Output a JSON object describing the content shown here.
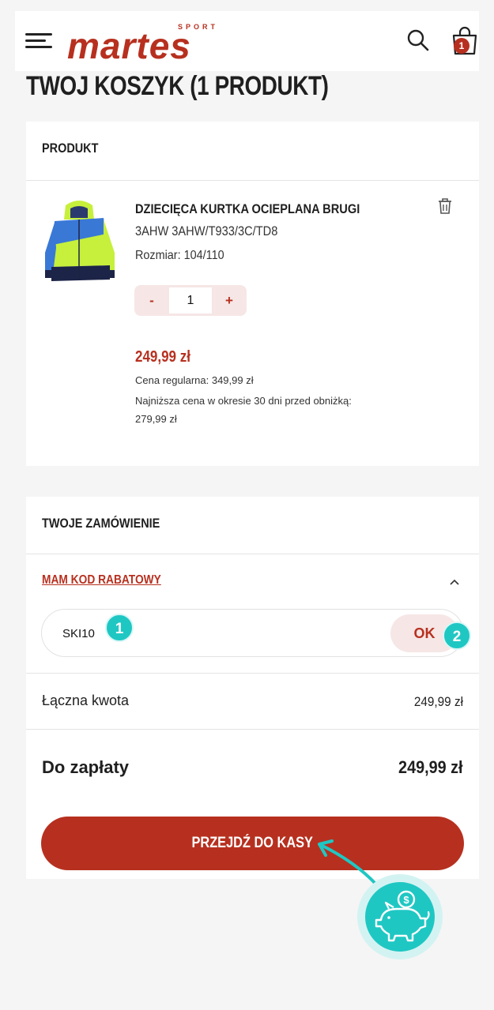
{
  "header": {
    "logo_text": "martes",
    "logo_sub": "SPORT",
    "cart_count": "1"
  },
  "page": {
    "title": "TWOJ KOSZYK (1 PRODUKT)"
  },
  "product_section": {
    "heading": "PRODUKT",
    "item": {
      "name": "DZIECIĘCA KURTKA OCIEPLANA BRUGI",
      "code": "3AHW 3AHW/T933/3C/TD8",
      "size": "Rozmiar: 104/110",
      "qty_minus": "-",
      "qty_value": "1",
      "qty_plus": "+",
      "price": "249,99 zł",
      "regular_price": "Cena regularna: 349,99 zł",
      "lowest_price_line1": "Najniższa cena w okresie 30 dni przed obniżką:",
      "lowest_price_line2": "279,99 zł"
    }
  },
  "order_section": {
    "heading": "TWOJE ZAMÓWIENIE",
    "discount_link": "MAM KOD RABATOWY",
    "discount_code": "SKI10",
    "ok_label": "OK",
    "total_label": "Łączna kwota",
    "total_value": "249,99 zł",
    "pay_label": "Do zapłaty",
    "pay_value": "249,99 zł",
    "checkout_label": "PRZEJDŹ DO KASY"
  },
  "annotations": {
    "step1": "1",
    "step2": "2",
    "piggy_coin": "$"
  },
  "colors": {
    "brand": "#b7301f",
    "accent_teal": "#1fc7c3",
    "light_pink": "#f6e6e6"
  }
}
